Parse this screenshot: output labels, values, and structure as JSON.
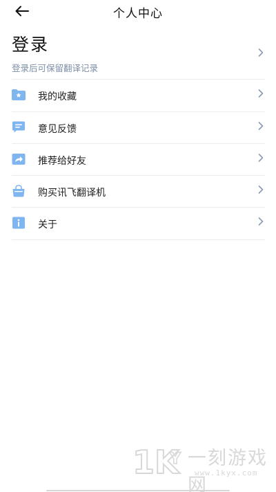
{
  "header": {
    "title": "个人中心"
  },
  "login": {
    "title": "登录",
    "subtitle": "登录后可保留翻译记录"
  },
  "menu": {
    "items": [
      {
        "label": "我的收藏",
        "icon": "folder-star-icon"
      },
      {
        "label": "意见反馈",
        "icon": "chat-message-icon"
      },
      {
        "label": "推荐给好友",
        "icon": "share-arrow-icon"
      },
      {
        "label": "购买讯飞翻译机",
        "icon": "shopping-bag-icon"
      },
      {
        "label": "关于",
        "icon": "info-icon"
      }
    ]
  },
  "watermark": {
    "brand": "1kyx",
    "text": "一刻游戏网",
    "url": "www.1kyx.com"
  },
  "colors": {
    "icon_accent": "#7fb6f0",
    "subtitle": "#7d8fa7",
    "divider": "#ececec"
  }
}
